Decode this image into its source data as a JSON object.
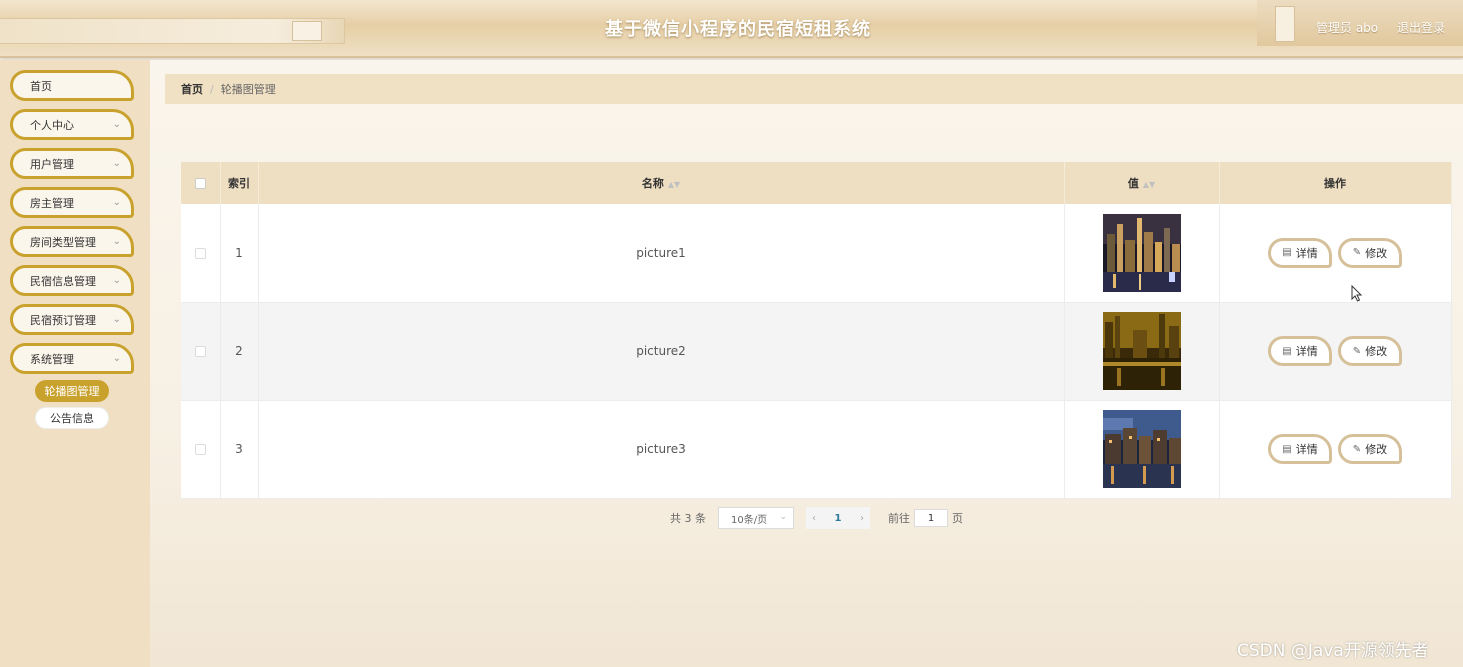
{
  "header": {
    "title": "基于微信小程序的民宿短租系统",
    "user": "管理员 abo",
    "logout": "退出登录"
  },
  "sidebar": {
    "items": [
      {
        "label": "首页",
        "expandable": false
      },
      {
        "label": "个人中心",
        "expandable": true
      },
      {
        "label": "用户管理",
        "expandable": true
      },
      {
        "label": "房主管理",
        "expandable": true
      },
      {
        "label": "房间类型管理",
        "expandable": true
      },
      {
        "label": "民宿信息管理",
        "expandable": true
      },
      {
        "label": "民宿预订管理",
        "expandable": true
      },
      {
        "label": "系统管理",
        "expandable": true
      }
    ],
    "subitems": [
      {
        "label": "轮播图管理",
        "active": true
      },
      {
        "label": "公告信息",
        "active": false
      }
    ]
  },
  "breadcrumb": {
    "home": "首页",
    "separator": "/",
    "current": "轮播图管理"
  },
  "table": {
    "columns": {
      "index": "索引",
      "name": "名称",
      "value": "值",
      "action": "操作"
    },
    "rows": [
      {
        "index": "1",
        "name": "picture1",
        "image": "night-city-skyline"
      },
      {
        "index": "2",
        "name": "picture2",
        "image": "golden-river-city"
      },
      {
        "index": "3",
        "name": "picture3",
        "image": "dusk-canal-buildings"
      }
    ],
    "detail_label": "详情",
    "edit_label": "修改"
  },
  "pagination": {
    "total": "共 3 条",
    "page_size": "10条/页",
    "current_page": "1",
    "goto_label": "前往",
    "goto_value": "1",
    "page_suffix": "页"
  },
  "watermark": "CSDN @Java开源领先者",
  "colors": {
    "accent": "#c9a22e",
    "header_bg": "#e6cfa6",
    "sidebar_bg": "#f0dfc2",
    "table_header_bg": "#efdfc2",
    "button_border": "#d5c09a"
  }
}
